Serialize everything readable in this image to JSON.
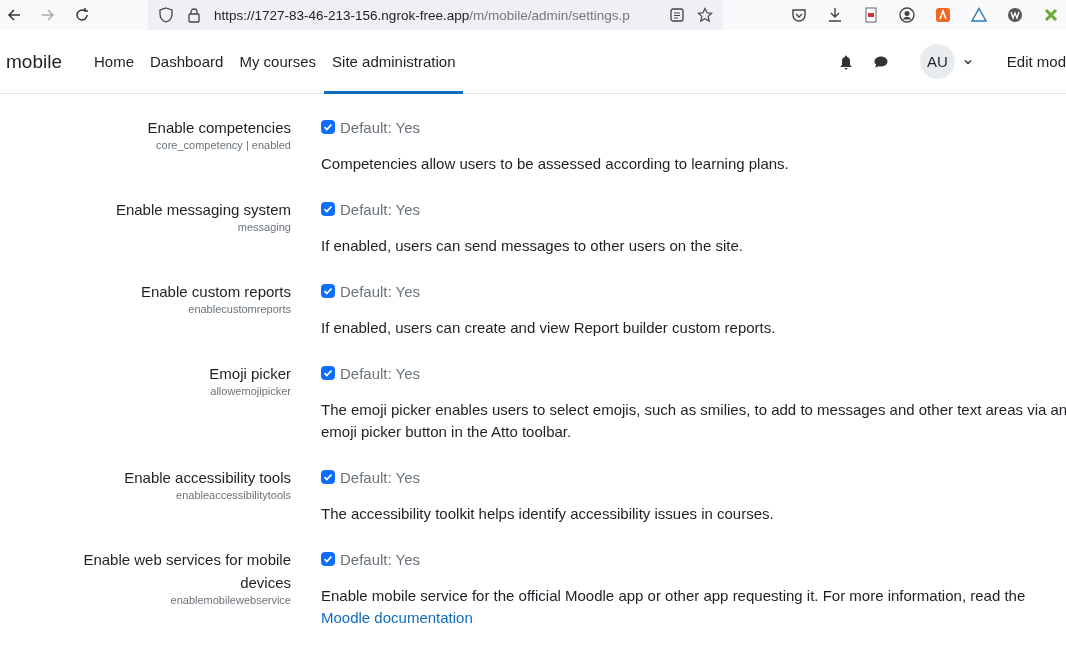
{
  "browser": {
    "url_host": "https://1727-83-46-213-156.ngrok-free.app",
    "url_path": "/m/mobile/admin/settings.p"
  },
  "navbar": {
    "brand": "mobile",
    "items": [
      {
        "label": "Home",
        "selected": false
      },
      {
        "label": "Dashboard",
        "selected": false
      },
      {
        "label": "My courses",
        "selected": false
      },
      {
        "label": "Site administration",
        "selected": true
      }
    ],
    "avatar": "AU",
    "edit_mode": "Edit mod"
  },
  "settings": [
    {
      "label": "Enable competencies",
      "name": "core_competency | enabled",
      "checked": true,
      "default": "Default: Yes",
      "description": "Competencies allow users to be assessed according to learning plans."
    },
    {
      "label": "Enable messaging system",
      "name": "messaging",
      "checked": true,
      "default": "Default: Yes",
      "description": "If enabled, users can send messages to other users on the site."
    },
    {
      "label": "Enable custom reports",
      "name": "enablecustomreports",
      "checked": true,
      "default": "Default: Yes",
      "description": "If enabled, users can create and view Report builder custom reports."
    },
    {
      "label": "Emoji picker",
      "name": "allowemojipicker",
      "checked": true,
      "default": "Default: Yes",
      "description": "The emoji picker enables users to select emojis, such as smilies, to add to messages and other text areas via an emoji picker button in the Atto toolbar."
    },
    {
      "label": "Enable accessibility tools",
      "name": "enableaccessibilitytools",
      "checked": true,
      "default": "Default: Yes",
      "description": "The accessibility toolkit helps identify accessibility issues in courses."
    },
    {
      "label": "Enable web services for mobile devices",
      "name": "enablemobilewebservice",
      "checked": true,
      "default": "Default: Yes",
      "description": "Enable mobile service for the official Moodle app or other app requesting it. For more information, read the",
      "link": "Moodle documentation"
    }
  ]
}
